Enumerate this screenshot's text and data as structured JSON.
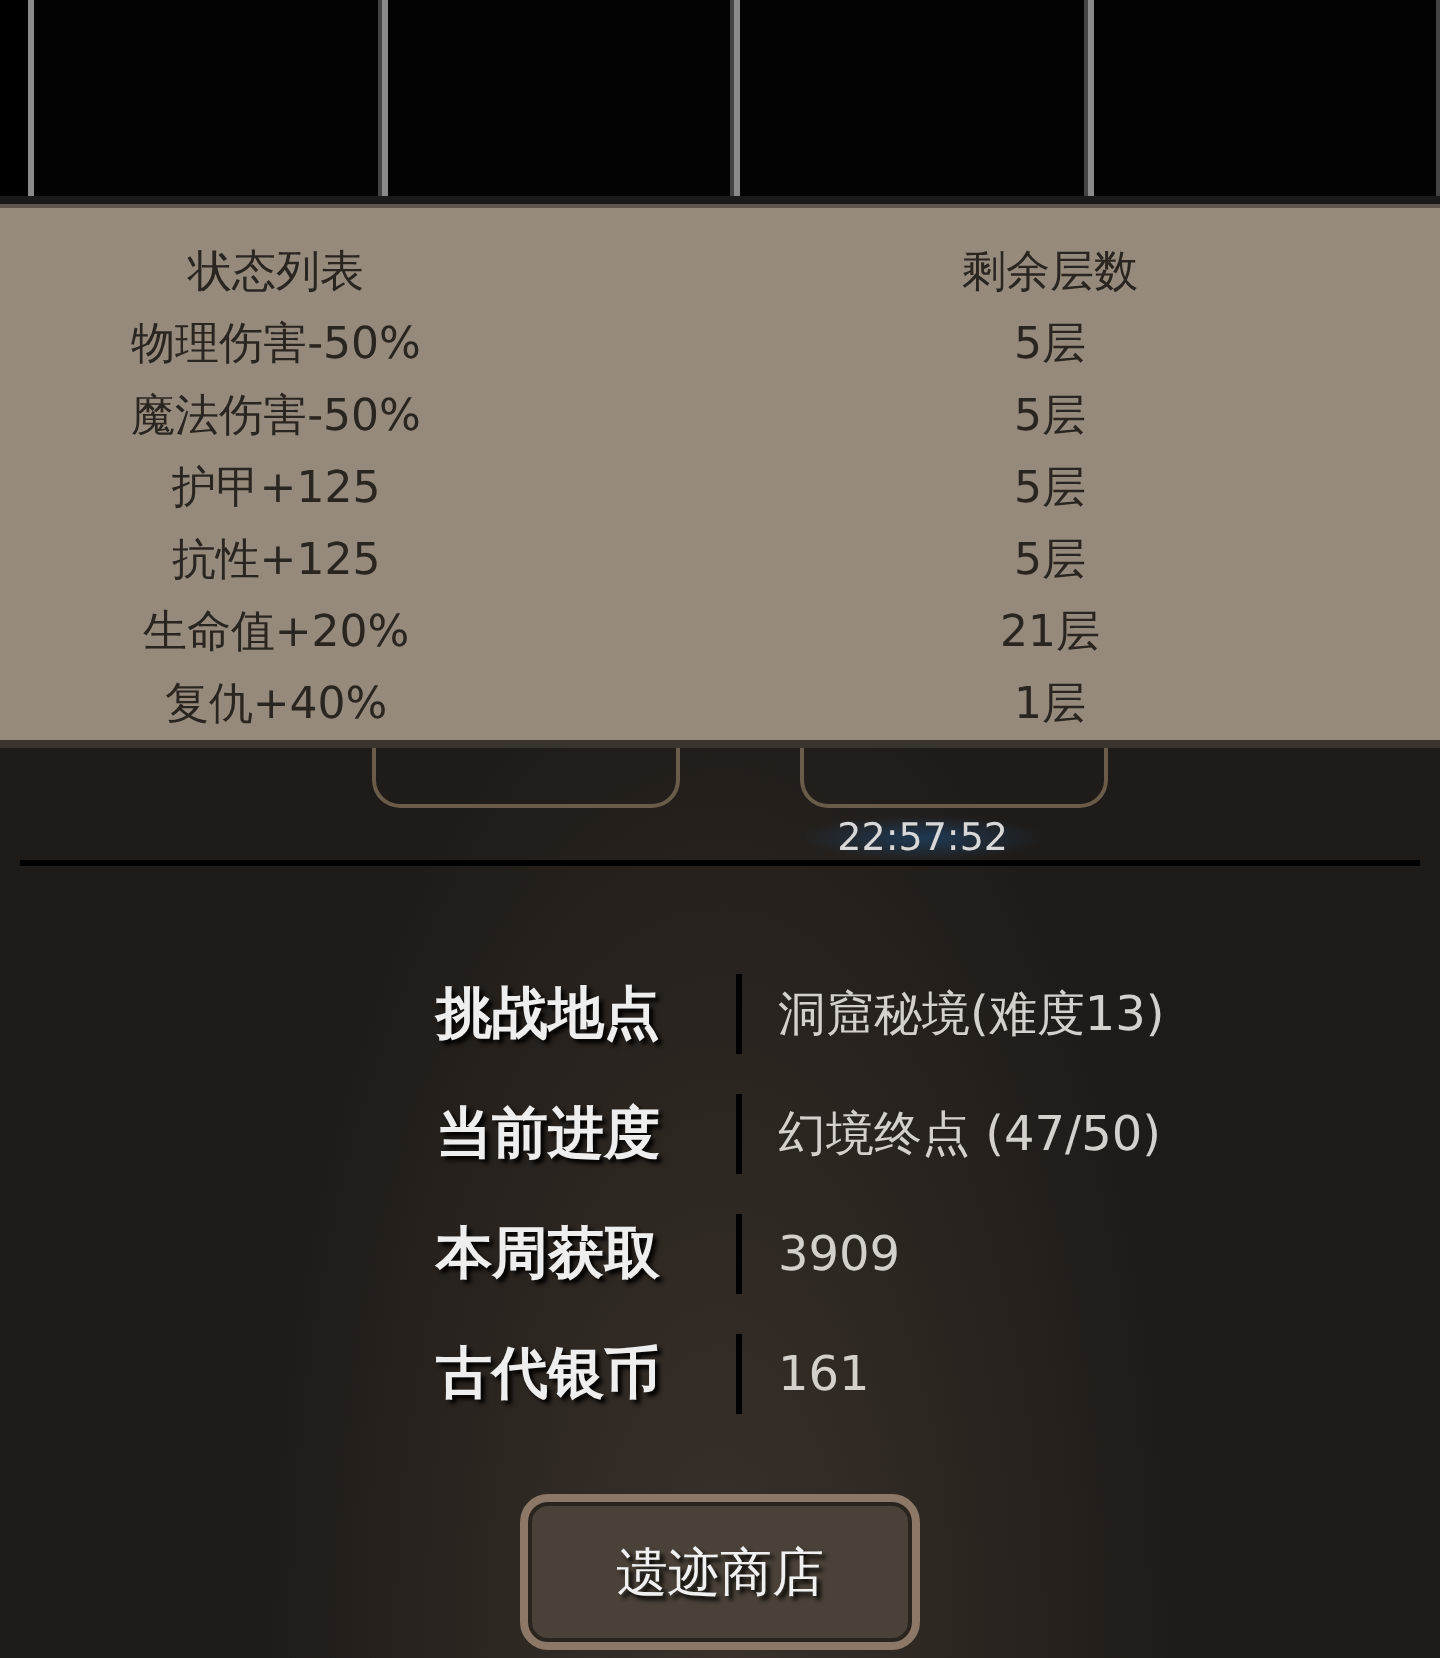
{
  "status_list": {
    "columns": [
      "状态列表",
      "剩余层数"
    ],
    "rows": [
      {
        "name": "物理伤害-50%",
        "layers": "5层"
      },
      {
        "name": "魔法伤害-50%",
        "layers": "5层"
      },
      {
        "name": "护甲+125",
        "layers": "5层"
      },
      {
        "name": "抗性+125",
        "layers": "5层"
      },
      {
        "name": "生命值+20%",
        "layers": "21层"
      },
      {
        "name": "复仇+40%",
        "layers": "1层"
      }
    ]
  },
  "timer": "22:57:52",
  "info": [
    {
      "label": "挑战地点",
      "value": "洞窟秘境(难度13)"
    },
    {
      "label": "当前进度",
      "value": "幻境终点 (47/50)"
    },
    {
      "label": "本周获取",
      "value": "3909"
    },
    {
      "label": "古代银币",
      "value": "161"
    }
  ],
  "shop_button": "遗迹商店"
}
